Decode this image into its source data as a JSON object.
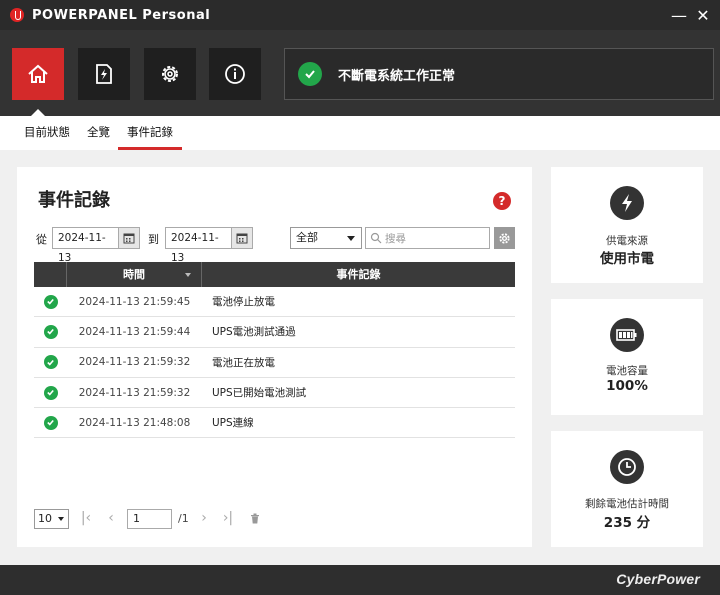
{
  "app": {
    "title": "POWERPANEL Personal"
  },
  "window": {
    "minimize": "—",
    "close": "✕"
  },
  "status": {
    "text": "不斷電系統工作正常",
    "color": "#22a64a"
  },
  "nav": {
    "items": [
      {
        "name": "home-icon",
        "active": true
      },
      {
        "name": "power-icon",
        "active": false
      },
      {
        "name": "settings-icon",
        "active": false
      },
      {
        "name": "info-icon",
        "active": false
      }
    ],
    "accent": "#d42a2a"
  },
  "subtabs": [
    "目前狀態",
    "全覽",
    "事件記錄"
  ],
  "events": {
    "title": "事件記錄",
    "help": "?",
    "from_label": "從",
    "to_label": "到",
    "date_from": "2024-11-13",
    "date_to": "2024-11-13",
    "filter": "全部",
    "search_placeholder": "搜尋",
    "columns": {
      "time": "時間",
      "event": "事件記錄"
    },
    "rows": [
      {
        "time": "2024-11-13 21:59:45",
        "event": "電池停止放電"
      },
      {
        "time": "2024-11-13 21:59:44",
        "event": "UPS電池測試通過"
      },
      {
        "time": "2024-11-13 21:59:32",
        "event": "電池正在放電"
      },
      {
        "time": "2024-11-13 21:59:32",
        "event": "UPS已開始電池測試"
      },
      {
        "time": "2024-11-13 21:48:08",
        "event": "UPS連線"
      }
    ],
    "pager": {
      "page_size": "10",
      "page": "1",
      "total": "/1"
    }
  },
  "cards": {
    "source": {
      "label": "供電來源",
      "value": "使用市電",
      "icon": "lightning-icon"
    },
    "capacity": {
      "label": "電池容量",
      "value": "100%",
      "icon": "battery-icon"
    },
    "runtime": {
      "label": "剩餘電池估計時間",
      "value": "235 分",
      "icon": "clock-icon"
    }
  },
  "footer": {
    "brand": "CyberPower"
  }
}
